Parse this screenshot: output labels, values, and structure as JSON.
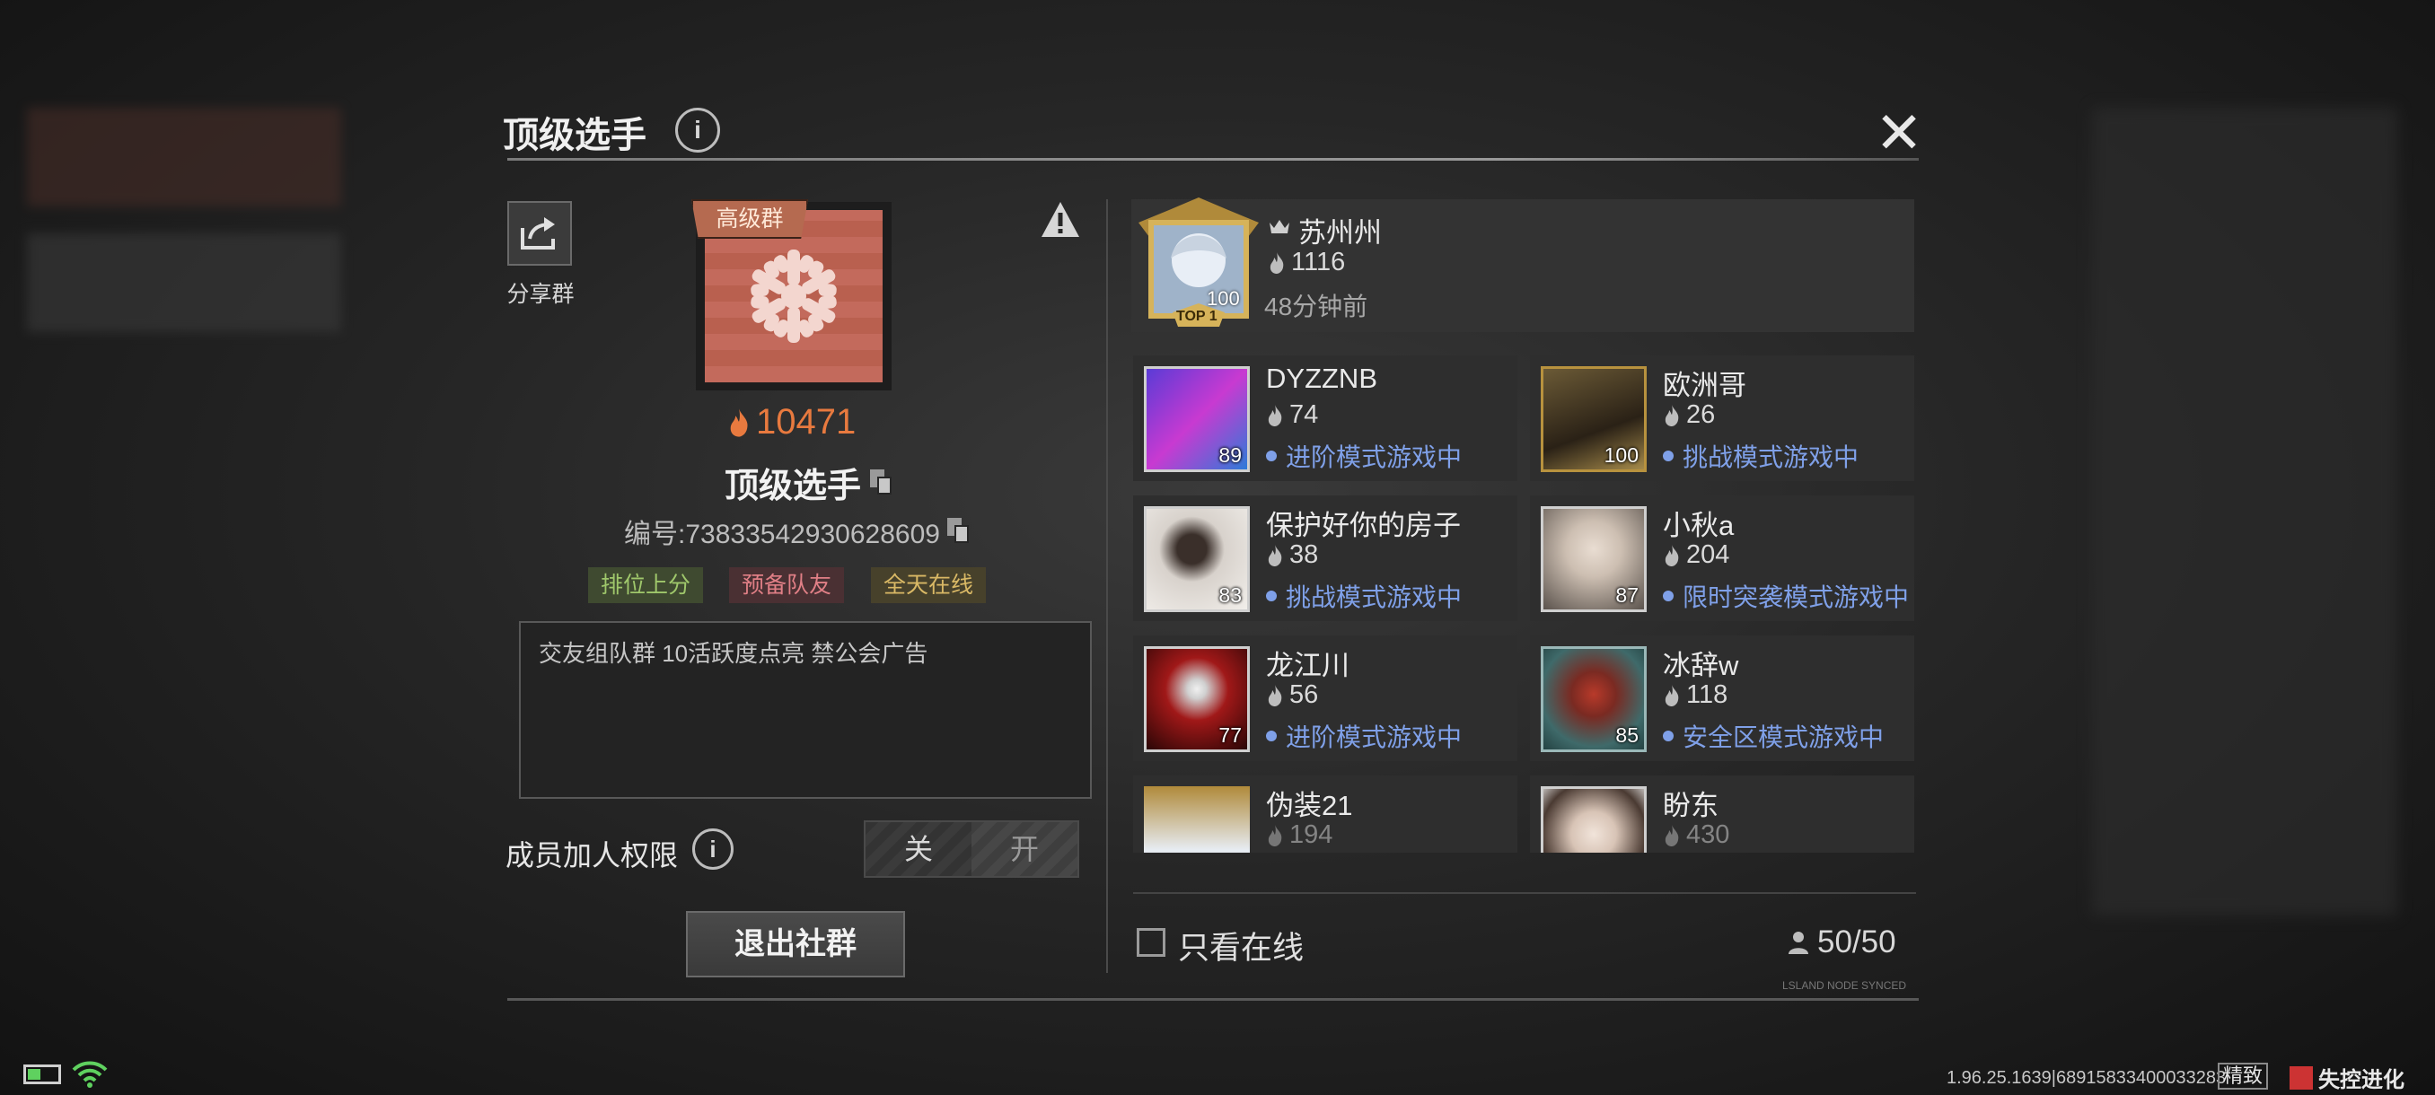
{
  "dialog": {
    "title": "顶级选手",
    "close_symbol": "✕"
  },
  "group": {
    "share_label": "分享群",
    "premium_tag": "高级群",
    "score": "10471",
    "name": "顶级选手",
    "id_text": "编号:73833542930628609",
    "tags": [
      "排位上分",
      "预备队友",
      "全天在线"
    ],
    "description": "交友组队群 10活跃度点亮 禁公会广告",
    "permission_label": "成员加人权限",
    "toggle_off": "关",
    "toggle_on": "开",
    "exit_button": "退出社群"
  },
  "top_member": {
    "name": "苏州州",
    "score": "1116",
    "last_seen": "48分钟前",
    "level": "100",
    "badge": "TOP 1"
  },
  "members": [
    {
      "name": "DYZZNB",
      "score": "74",
      "status": "进阶模式游戏中",
      "level": "89"
    },
    {
      "name": "欧洲哥",
      "score": "26",
      "status": "挑战模式游戏中",
      "level": "100"
    },
    {
      "name": "保护好你的房子",
      "score": "38",
      "status": "挑战模式游戏中",
      "level": "83"
    },
    {
      "name": "小秋a",
      "score": "204",
      "status": "限时突袭模式游戏中",
      "level": "87"
    },
    {
      "name": "龙江川",
      "score": "56",
      "status": "进阶模式游戏中",
      "level": "77"
    },
    {
      "name": "冰辞w",
      "score": "118",
      "status": "安全区模式游戏中",
      "level": "85"
    },
    {
      "name": "伪装21",
      "score": "194",
      "status": "",
      "level": ""
    },
    {
      "name": "盼东",
      "score": "430",
      "status": "",
      "level": ""
    }
  ],
  "footer": {
    "online_only_label": "只看在线",
    "member_count": "50/50",
    "synced_text": "LSLAND NODE SYNCED"
  },
  "system_bar": {
    "version": "1.96.25.1639|68915833400033283",
    "quality": "精致",
    "brand": "失控进化"
  },
  "colors": {
    "accent_orange": "#e87a3f",
    "status_blue": "#7fa0e8"
  }
}
